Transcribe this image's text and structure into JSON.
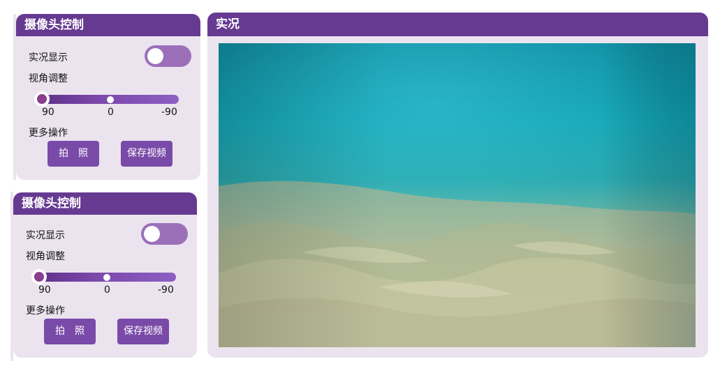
{
  "control_panels": [
    {
      "title": "摄像头控制",
      "live_display_label": "实况显示",
      "angle_label": "视角调整",
      "ticks": [
        "90",
        "0",
        "-90"
      ],
      "more_label": "更多操作",
      "photo_button": "拍　照",
      "save_button": "保存视频",
      "live_display_on": false,
      "angle_value": 90
    },
    {
      "title": "摄像头控制",
      "live_display_label": "实况显示",
      "angle_label": "视角调整",
      "ticks": [
        "90",
        "0",
        "-90"
      ],
      "more_label": "更多操作",
      "photo_button": "拍　照",
      "save_button": "保存视频",
      "live_display_on": false,
      "angle_value": 90
    }
  ],
  "live_view": {
    "title": "实况",
    "image_icon": "underwater-sand-photo"
  },
  "colors": {
    "header": "#663a91",
    "panel_bg": "#ebe4ef",
    "button": "#7a4aa8",
    "toggle": "#9b70b9"
  }
}
